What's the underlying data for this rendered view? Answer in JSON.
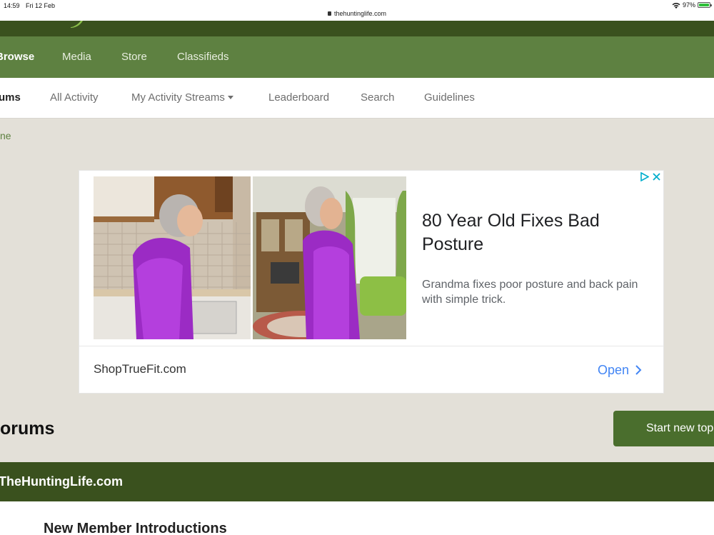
{
  "status_bar": {
    "time": "14:59",
    "date": "Fri 12 Feb",
    "url": "thehuntinglife.com",
    "battery": "97%"
  },
  "primary_nav": {
    "items": [
      {
        "label": "Browse",
        "active": true
      },
      {
        "label": "Media"
      },
      {
        "label": "Store"
      },
      {
        "label": "Classifieds"
      }
    ]
  },
  "secondary_nav": {
    "items": [
      {
        "label": "Forums",
        "active": true,
        "visible_text": "ums"
      },
      {
        "label": "All Activity"
      },
      {
        "label": "My Activity Streams"
      },
      {
        "label": "Leaderboard"
      },
      {
        "label": "Search"
      },
      {
        "label": "Guidelines"
      }
    ]
  },
  "breadcrumb": {
    "label": "ne"
  },
  "ad": {
    "headline": "80 Year Old Fixes Bad Posture",
    "description": "Grandma fixes poor posture and back pain with simple trick.",
    "advertiser": "ShopTrueFit.com",
    "cta": "Open"
  },
  "page": {
    "title": "orums",
    "start_button": "Start new top"
  },
  "category": {
    "title": "TheHuntingLife.com",
    "forums": [
      {
        "name": "New Member Introductions"
      }
    ]
  },
  "colors": {
    "nav_green": "#5e8141",
    "dark_green": "#3a511e",
    "button_green": "#4a6e2d",
    "page_bg": "#e3e0d8",
    "link_blue": "#4285f4"
  }
}
